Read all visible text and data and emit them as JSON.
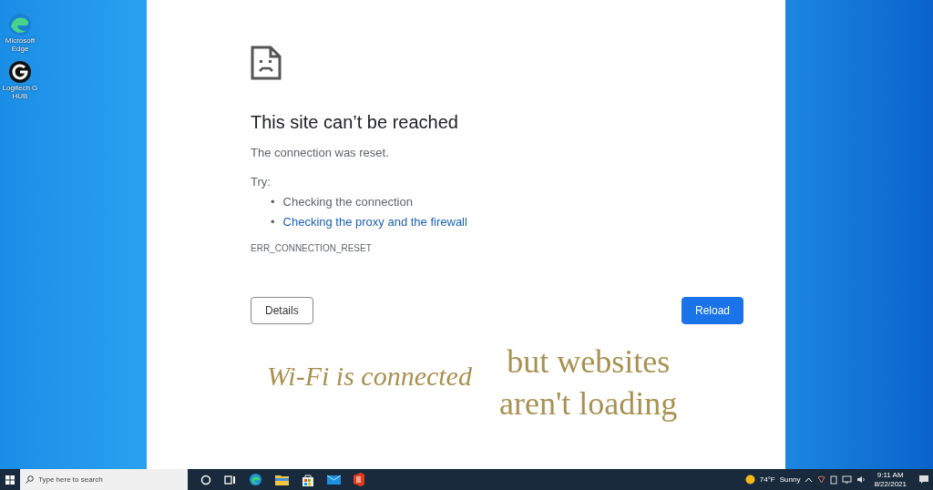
{
  "desktop_icons": [
    {
      "label": "Microsoft Edge",
      "kind": "edge"
    },
    {
      "label": "Logitech G HUB",
      "kind": "ghub"
    }
  ],
  "error_page": {
    "heading": "This site can’t be reached",
    "message": "The connection was reset.",
    "try_label": "Try:",
    "suggestions": [
      {
        "bullet": "•",
        "text": "Checking the connection",
        "kind": "text"
      },
      {
        "bullet": "•",
        "text": "Checking the proxy and the firewall",
        "kind": "link"
      }
    ],
    "error_code": "ERR_CONNECTION_RESET",
    "buttons": [
      {
        "label": "Details",
        "kind": "secondary"
      },
      {
        "label": "Reload",
        "kind": "primary"
      }
    ]
  },
  "caption": {
    "left": "Wi-Fi is connected",
    "right_lines": [
      "but websites",
      "aren't loading"
    ]
  },
  "taskbar": {
    "search": {
      "placeholder": "Type here to search"
    },
    "apps": [
      {
        "kind": "cortana"
      },
      {
        "kind": "taskview"
      },
      {
        "kind": "edge"
      },
      {
        "kind": "explorer"
      },
      {
        "kind": "store"
      },
      {
        "kind": "mail"
      },
      {
        "kind": "office"
      }
    ],
    "weather": {
      "temperature": "74°F",
      "condition": "Sunny"
    },
    "time": "9:11 AM",
    "date": "8/22/2021"
  }
}
